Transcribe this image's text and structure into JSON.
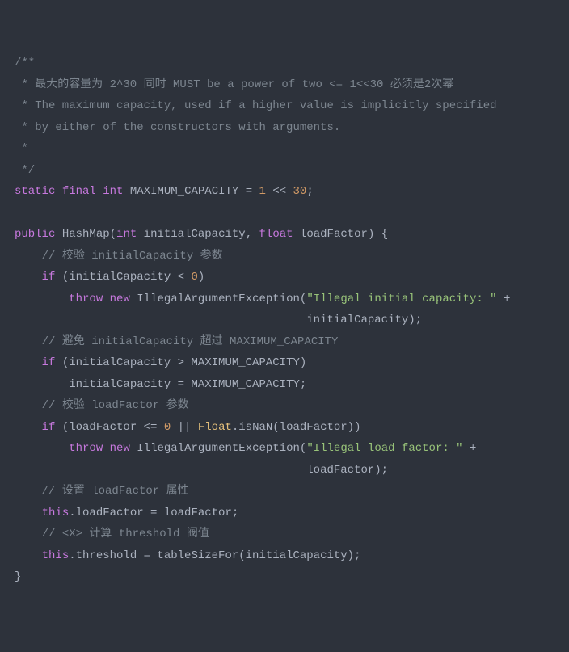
{
  "code": {
    "c1": "/**",
    "c2": " * 最大的容量为 2^30 同时 MUST be a power of two <= 1<<30 必须是2次幂",
    "c3": " * The maximum capacity, used if a higher value is implicitly specified",
    "c4": " * by either of the constructors with arguments.",
    "c5": " *",
    "c6": " */",
    "l1_kw1": "static",
    "l1_kw2": "final",
    "l1_ty": "int",
    "l1_name": "MAXIMUM_CAPACITY",
    "l1_eq": " = ",
    "l1_n1": "1",
    "l1_op": " << ",
    "l1_n2": "30",
    "l1_semi": ";",
    "l2_kw": "public",
    "l2_cls": "HashMap",
    "l2_ty1": "int",
    "l2_p1": "initialCapacity",
    "l2_ty2": "float",
    "l2_p2": "loadFactor",
    "l2_open": "(",
    "l2_comma": ", ",
    "l2_close": ") {",
    "cA": "// 校验 initialCapacity 参数",
    "l3_if": "if",
    "l3_open": " (initialCapacity < ",
    "l3_zero": "0",
    "l3_close": ")",
    "l4_throw": "throw",
    "l4_new": "new",
    "l4_cls": "IllegalArgumentException",
    "l4_open": "(",
    "l4_str": "\"Illegal initial capacity: \"",
    "l4_plus": " +",
    "l5_txt": "initialCapacity);",
    "cB": "// 避免 initialCapacity 超过 MAXIMUM_CAPACITY",
    "l6_if": "if",
    "l6_body": " (initialCapacity > MAXIMUM_CAPACITY)",
    "l7_body": "initialCapacity = MAXIMUM_CAPACITY;",
    "cC": "// 校验 loadFactor 参数",
    "l8_if": "if",
    "l8_a": " (loadFactor <= ",
    "l8_zero": "0",
    "l8_b": " || ",
    "l8_cls": "Float",
    "l8_c": ".isNaN(loadFactor))",
    "l9_throw": "throw",
    "l9_new": "new",
    "l9_cls": "IllegalArgumentException",
    "l9_open": "(",
    "l9_str": "\"Illegal load factor: \"",
    "l9_plus": " +",
    "l10_txt": "loadFactor);",
    "cD": "// 设置 loadFactor 属性",
    "l11_this": "this",
    "l11_rest": ".loadFactor = loadFactor;",
    "cE": "// <X> 计算 threshold 阀值",
    "l12_this": "this",
    "l12_rest": ".threshold = tableSizeFor(initialCapacity);",
    "l13": "}"
  }
}
